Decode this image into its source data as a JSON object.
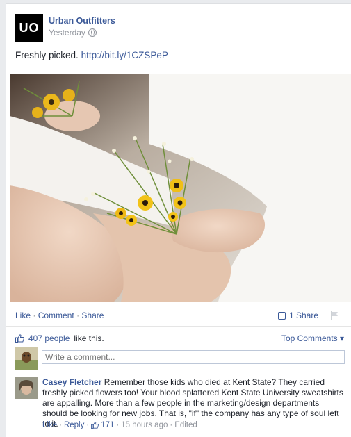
{
  "post": {
    "page_logo_text": "UO",
    "page_name": "Urban Outfitters",
    "time": "Yesterday",
    "text_prefix": "Freshly picked.",
    "link": "http://bit.ly/1CZSPeP"
  },
  "actions": {
    "like": "Like",
    "comment": "Comment",
    "share": "Share",
    "separator": "·",
    "share_count": "1 Share"
  },
  "likes": {
    "count_text": "407 people",
    "suffix": "like this.",
    "top_comments": "Top Comments ▾"
  },
  "comment_input": {
    "placeholder": "Write a comment..."
  },
  "comment": {
    "author": "Casey Fletcher",
    "text": "Remember those kids who died at Kent State? They carried freshly picked flowers too! Your blood splattered Kent State University sweatshirts are appalling. More than a few people in the marketing/design departments should be looking for new jobs. That is, \"if\" the company has any type of soul left to it.",
    "like": "Like",
    "reply": "Reply",
    "like_count": "171",
    "time": "15 hours ago",
    "edited": "Edited",
    "separator": "·"
  },
  "colors": {
    "link_blue": "#3b5998",
    "meta_gray": "#90949c"
  }
}
